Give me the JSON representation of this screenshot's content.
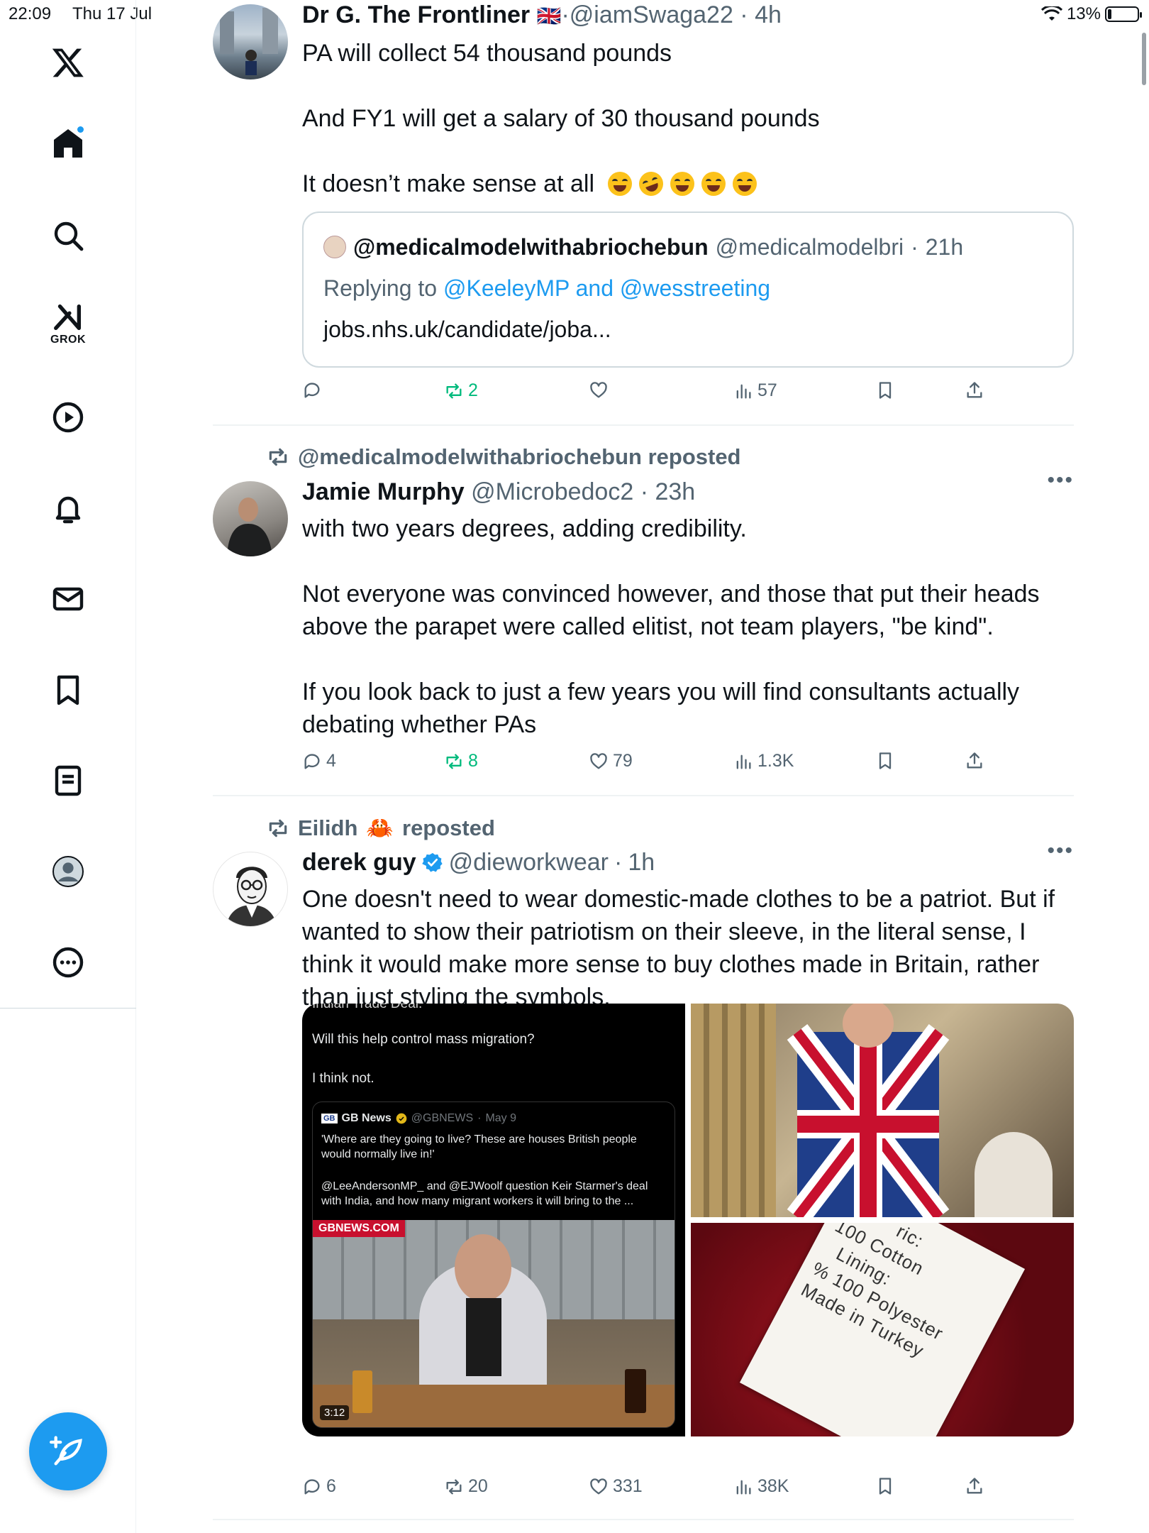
{
  "status_bar": {
    "time": "22:09",
    "date": "Thu 17 Jul",
    "battery": "13%",
    "battery_level": 0.13
  },
  "sidebar": {
    "items": [
      {
        "name": "x-logo"
      },
      {
        "name": "home",
        "notification_dot": true
      },
      {
        "name": "search"
      },
      {
        "name": "grok",
        "label": "GROK"
      },
      {
        "name": "video"
      },
      {
        "name": "notifications"
      },
      {
        "name": "messages"
      },
      {
        "name": "bookmarks"
      },
      {
        "name": "lists"
      },
      {
        "name": "profile"
      },
      {
        "name": "more"
      }
    ]
  },
  "tweets": [
    {
      "name": "Dr G. The Frontliner",
      "flag": "🇬🇧",
      "handle": "@iamSwaga22",
      "time": "4h",
      "paragraphs": [
        "PA will collect 54 thousand pounds",
        "And FY1 will get a salary of 30 thousand pounds",
        "It doesn’t make sense at all"
      ],
      "quote": {
        "name": "@medicalmodelwithabriochebun",
        "handle": "@medicalmodelbri",
        "time": "21h",
        "replying_prefix": "Replying to",
        "replying_to": "@KeeleyMP and @wesstreeting",
        "text": "jobs.nhs.uk/candidate/joba..."
      },
      "stats": {
        "replies": "",
        "reposts": "2",
        "likes": "",
        "views": "57"
      }
    },
    {
      "repost_by": "@medicalmodelwithabriochebun reposted",
      "name": "Jamie Murphy",
      "handle": "@Microbedoc2",
      "time": "23h",
      "paragraphs": [
        "with two years degrees, adding credibility.",
        "Not everyone was convinced however, and those that put their heads above the parapet were called elitist, not team players, \"be kind\".",
        "If you look back to just a few years you will find consultants actually debating whether PAs"
      ],
      "stats": {
        "replies": "4",
        "reposts": "8",
        "likes": "79",
        "views": "1.3K"
      }
    },
    {
      "repost_by_name": "Eilidh",
      "repost_by_emoji": "🦀",
      "repost_suffix": "reposted",
      "name": "derek guy",
      "handle": "@dieworkwear",
      "time": "1h",
      "paragraphs": [
        "One doesn't need to wear domestic-made clothes to be a patriot. But if wanted to show their patriotism on their sleeve, in the literal sense, I think it would make more sense to buy clothes made in Britain, rather than just styling the symbols."
      ],
      "media": {
        "screenshot": {
          "top_fragment": "Indian Trade Deal.",
          "line1": "Will this help control mass migration?",
          "line2": "I think not.",
          "embed_logo": "GB",
          "embed_name": "GB News",
          "embed_handle": "@GBNEWS",
          "embed_date": "May 9",
          "embed_text1": "'Where are they going to live? These are houses British people would normally live in!'",
          "embed_text2": "@LeeAndersonMP_ and @EJWoolf question Keir Starmer's deal with India, and how many migrant workers it will bring to the ...",
          "banner": "GBNEWS.COM",
          "duration": "3:12"
        },
        "label_lines": [
          "ric:",
          "100 Cotton",
          "Lining:",
          "% 100 Polyester",
          "Made in Turkey"
        ]
      },
      "stats": {
        "replies": "6",
        "reposts": "20",
        "likes": "331",
        "views": "38K"
      }
    }
  ]
}
